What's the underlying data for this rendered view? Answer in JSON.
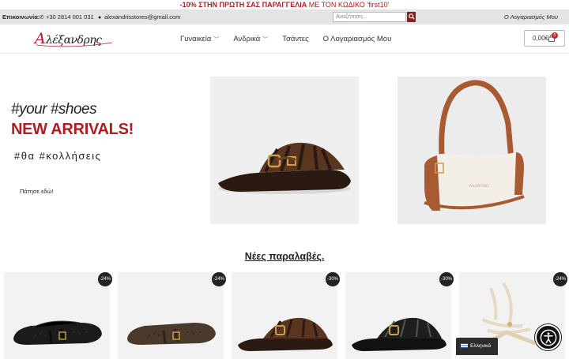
{
  "promo": {
    "part1": "-10% ΣΤΗΝ ΠΡΩΤΗ ΣΑΣ ΠΑΡΑΓΓΕΛΙΑ",
    "part2": " ΜΕ ΤΟΝ ΚΩΔΙΚΟ ",
    "part3": "'first10'"
  },
  "contact": {
    "label": "Επικοινωνία:",
    "phone": "+30 2814 001 031",
    "email": "alexandrisstores@gmail.com",
    "search_placeholder": "Αναζήτηση...",
    "account_link": "Ο Λογαριασμός Μου"
  },
  "header": {
    "logo_text": "Αλέξανδρης",
    "nav": [
      {
        "label": "Γυναικεία"
      },
      {
        "label": "Ανδρικά"
      },
      {
        "label": "Τσάντες"
      },
      {
        "label": "Ο Λογαριασμός Μου"
      }
    ],
    "cart_total": "0,00€",
    "cart_count": "0"
  },
  "hero": {
    "line1": "#your #shoes",
    "line2": "NEW ARRIVALS!",
    "line3": "#θα #κολλήσεις",
    "button": "Πάτησε εδώ!"
  },
  "section_title": "Νέες παραλαβές.",
  "products": [
    {
      "discount": "-24%"
    },
    {
      "discount": "-24%"
    },
    {
      "discount": "-30%"
    },
    {
      "discount": "-30%"
    },
    {
      "discount": "-24%"
    }
  ],
  "language": "Ελληνικά",
  "colors": {
    "brand_red": "#b01c22",
    "dark": "#222222"
  }
}
